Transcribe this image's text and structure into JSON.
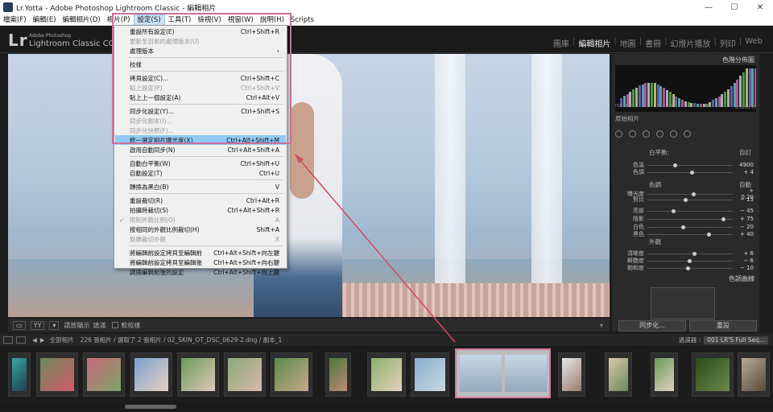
{
  "window": {
    "title": "Lr.Yotta - Adobe Photoshop Lightroom Classic - 編輯相片",
    "min": "—",
    "max": "☐",
    "close": "✕"
  },
  "menubar": [
    "檔案(F)",
    "編輯(E)",
    "編輯相片(D)",
    "相片(P)",
    "設定(S)",
    "工具(T)",
    "檢視(V)",
    "視窗(W)",
    "說明(H)",
    "Scripts"
  ],
  "identity": {
    "lr": "Lr",
    "sub1": "Adobe Photoshop",
    "sub2": "Lightroom Classic CC"
  },
  "modules": [
    "圖庫",
    "編輯相片",
    "地圖",
    "書冊",
    "幻燈片播放",
    "列印",
    "Web"
  ],
  "settings_menu": [
    {
      "label": "重設所有設定(E)",
      "shortcut": "Ctrl+Shift+R",
      "dis": false
    },
    {
      "label": "更新至目前的處理版本(U)",
      "shortcut": "",
      "dis": true
    },
    {
      "label": "處理版本",
      "shortcut": "›",
      "dis": false
    },
    {
      "sep": true
    },
    {
      "label": "校樣",
      "shortcut": "",
      "dis": false
    },
    {
      "sep": true
    },
    {
      "label": "拷貝設定(C)...",
      "shortcut": "Ctrl+Shift+C",
      "dis": false
    },
    {
      "label": "貼上設定(P)",
      "shortcut": "Ctrl+Shift+V",
      "dis": true
    },
    {
      "label": "貼上上一個設定(A)",
      "shortcut": "Ctrl+Alt+V",
      "dis": false
    },
    {
      "sep": true
    },
    {
      "label": "同步化設定(Y)...",
      "shortcut": "Ctrl+Shift+S",
      "dis": false
    },
    {
      "label": "同步化副本(I)...",
      "shortcut": "",
      "dis": true
    },
    {
      "label": "同步化快照(F)...",
      "shortcut": "",
      "dis": true
    },
    {
      "label": "統一選定相片曝光度(X)",
      "shortcut": "Ctrl+Alt+Shift+M",
      "dis": false,
      "hl": true
    },
    {
      "label": "啟用自動同步(N)",
      "shortcut": "Ctrl+Alt+Shift+A",
      "dis": false
    },
    {
      "sep": true
    },
    {
      "label": "自動白平衡(W)",
      "shortcut": "Ctrl+Shift+U",
      "dis": false
    },
    {
      "label": "自動設定(T)",
      "shortcut": "Ctrl+U",
      "dis": false
    },
    {
      "sep": true
    },
    {
      "label": "轉換為黑白(B)",
      "shortcut": "V",
      "dis": false
    },
    {
      "sep": true
    },
    {
      "label": "重設裁切(R)",
      "shortcut": "Ctrl+Alt+R",
      "dis": false
    },
    {
      "label": "拍攝時裁切(S)",
      "shortcut": "Ctrl+Alt+Shift+R",
      "dis": false
    },
    {
      "label": "限制外觀比例(O)",
      "shortcut": "A",
      "dis": true,
      "check": true
    },
    {
      "label": "按相同的外觀比例裁切(H)",
      "shortcut": "Shift+A",
      "dis": false
    },
    {
      "label": "旋轉裁切外觀",
      "shortcut": "X",
      "dis": true
    },
    {
      "sep": true
    },
    {
      "label": "將編輯前設定拷貝至編輯前",
      "shortcut": "Ctrl+Alt+Shift+向左鍵",
      "dis": false
    },
    {
      "label": "將編輯前設定拷貝至編輯後",
      "shortcut": "Ctrl+Alt+Shift+向右鍵",
      "dis": false
    },
    {
      "label": "調換編輯前後的設定",
      "shortcut": "Ctrl+Alt+Shift+向上鍵",
      "dis": false
    }
  ],
  "right_panel": {
    "histogram": "色階分佈圖",
    "histo_foot": [
      "ISO 200",
      "85 mm",
      "f / 2.8",
      "1/3200 秒"
    ],
    "original": "原始相片",
    "wb": "白平衡:",
    "wb_val": "自訂",
    "tone": "色調",
    "tone_auto": "自動",
    "presence": "外觀",
    "tonecurve": "色調曲線",
    "sliders": [
      {
        "label": "色溫",
        "value": "4900",
        "pos": 0.3
      },
      {
        "label": "色調",
        "value": "+ 4",
        "pos": 0.5
      },
      {
        "label": "曝光度",
        "value": "+ 0.20",
        "pos": 0.52
      },
      {
        "label": "對比",
        "value": "− 15",
        "pos": 0.42
      },
      {
        "label": "亮部",
        "value": "− 45",
        "pos": 0.28
      },
      {
        "label": "陰影",
        "value": "+ 75",
        "pos": 0.87
      },
      {
        "label": "白色",
        "value": "− 20",
        "pos": 0.4
      },
      {
        "label": "黑色",
        "value": "+ 40",
        "pos": 0.7
      },
      {
        "label": "清晰度",
        "value": "+ 6",
        "pos": 0.53
      },
      {
        "label": "鮮艷度",
        "value": "− 6",
        "pos": 0.47
      },
      {
        "label": "飽和度",
        "value": "− 10",
        "pos": 0.45
      }
    ],
    "sync": "同步化...",
    "reset": "重設"
  },
  "toolbar": {
    "show": "請放顯示",
    "fill": "填滿",
    "softproof": "軟校樣"
  },
  "filmstrip": {
    "nav": "全部相片",
    "info": "226 張相片 / 選取了 2 張相片 / 02_SKIN_OT_DSC_0629-2.dng / 副本_1",
    "filter": "過濾器 :",
    "filter_val": "001 LR'S Full Seq..."
  }
}
